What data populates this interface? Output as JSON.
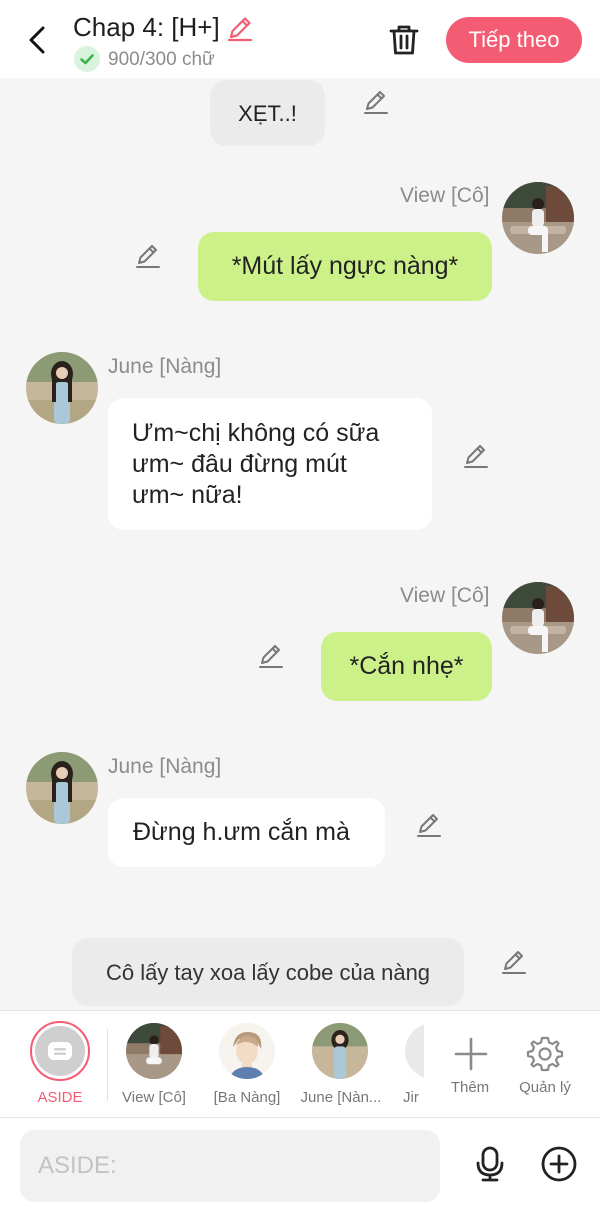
{
  "header": {
    "title": "Chap 4: [H+]",
    "word_count": "900/300 chữ",
    "next_label": "Tiếp theo",
    "accent": "#f45c74"
  },
  "messages": [
    {
      "type": "narration",
      "text": "XẸT..!"
    },
    {
      "type": "right",
      "sender": "View [Cô]",
      "text": "*Mút lấy ngực nàng*"
    },
    {
      "type": "left",
      "sender": "June [Nàng]",
      "lines": [
        "Ưm~chị không có sữa",
        "ưm~ đâu đừng mút",
        "ưm~ nữa!"
      ]
    },
    {
      "type": "right",
      "sender": "View [Cô]",
      "text": "*Cắn nhẹ*"
    },
    {
      "type": "left",
      "sender": "June [Nàng]",
      "text": "Đừng h.ưm cắn mà"
    },
    {
      "type": "narration",
      "text": "Cô lấy tay xoa lấy cobe của nàng"
    }
  ],
  "characters": [
    {
      "label": "ASIDE",
      "selected": true
    },
    {
      "label": "View [Cô]"
    },
    {
      "label": "[Ba Nàng]"
    },
    {
      "label": "June [Nàn..."
    },
    {
      "label": "Jir"
    }
  ],
  "actions": {
    "add": "Thêm",
    "manage": "Quản lý"
  },
  "input": {
    "placeholder": "ASIDE:"
  },
  "colors": {
    "bubble_right": "#cdf189",
    "bubble_left": "#ffffff",
    "narration": "#ebebeb",
    "accent": "#f45c74"
  }
}
